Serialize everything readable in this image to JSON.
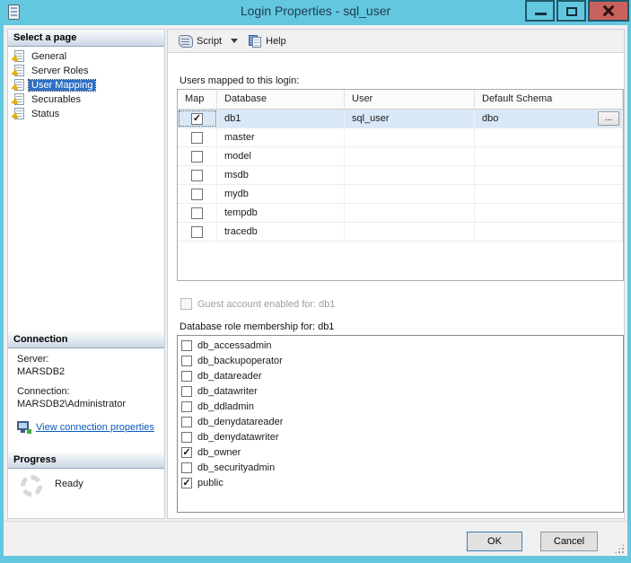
{
  "window": {
    "title": "Login Properties - sql_user"
  },
  "colors": {
    "titlebar": "#63c7e0",
    "close_button": "#c9615c",
    "selection_blue": "#2e6fc4",
    "selected_row": "#d9e8f7",
    "link": "#0b5bbd"
  },
  "sidebar": {
    "select_page": {
      "header": "Select a page",
      "items": [
        {
          "label": "General",
          "selected": false
        },
        {
          "label": "Server Roles",
          "selected": false
        },
        {
          "label": "User Mapping",
          "selected": true
        },
        {
          "label": "Securables",
          "selected": false
        },
        {
          "label": "Status",
          "selected": false
        }
      ]
    },
    "connection": {
      "header": "Connection",
      "server_label": "Server:",
      "server_value": "MARSDB2",
      "connection_label": "Connection:",
      "connection_value": "MARSDB2\\Administrator",
      "link_label": "View connection properties"
    },
    "progress": {
      "header": "Progress",
      "status": "Ready"
    }
  },
  "toolbar": {
    "script_label": "Script",
    "help_label": "Help"
  },
  "main": {
    "users_mapped_label": "Users mapped to this login:",
    "grid": {
      "columns": [
        "Map",
        "Database",
        "User",
        "Default Schema"
      ],
      "browse_label": "...",
      "rows": [
        {
          "map_checked": true,
          "database": "db1",
          "user": "sql_user",
          "default_schema": "dbo",
          "selected": true,
          "has_browse": true
        },
        {
          "map_checked": false,
          "database": "master",
          "user": "",
          "default_schema": "",
          "selected": false,
          "has_browse": false
        },
        {
          "map_checked": false,
          "database": "model",
          "user": "",
          "default_schema": "",
          "selected": false,
          "has_browse": false
        },
        {
          "map_checked": false,
          "database": "msdb",
          "user": "",
          "default_schema": "",
          "selected": false,
          "has_browse": false
        },
        {
          "map_checked": false,
          "database": "mydb",
          "user": "",
          "default_schema": "",
          "selected": false,
          "has_browse": false
        },
        {
          "map_checked": false,
          "database": "tempdb",
          "user": "",
          "default_schema": "",
          "selected": false,
          "has_browse": false
        },
        {
          "map_checked": false,
          "database": "tracedb",
          "user": "",
          "default_schema": "",
          "selected": false,
          "has_browse": false
        }
      ]
    },
    "guest_label": "Guest account enabled for: db1",
    "guest_checked": false,
    "roles_label": "Database role membership for: db1",
    "roles": [
      {
        "name": "db_accessadmin",
        "checked": false
      },
      {
        "name": "db_backupoperator",
        "checked": false
      },
      {
        "name": "db_datareader",
        "checked": false
      },
      {
        "name": "db_datawriter",
        "checked": false
      },
      {
        "name": "db_ddladmin",
        "checked": false
      },
      {
        "name": "db_denydatareader",
        "checked": false
      },
      {
        "name": "db_denydatawriter",
        "checked": false
      },
      {
        "name": "db_owner",
        "checked": true
      },
      {
        "name": "db_securityadmin",
        "checked": false
      },
      {
        "name": "public",
        "checked": true
      }
    ]
  },
  "footer": {
    "ok_label": "OK",
    "cancel_label": "Cancel"
  }
}
